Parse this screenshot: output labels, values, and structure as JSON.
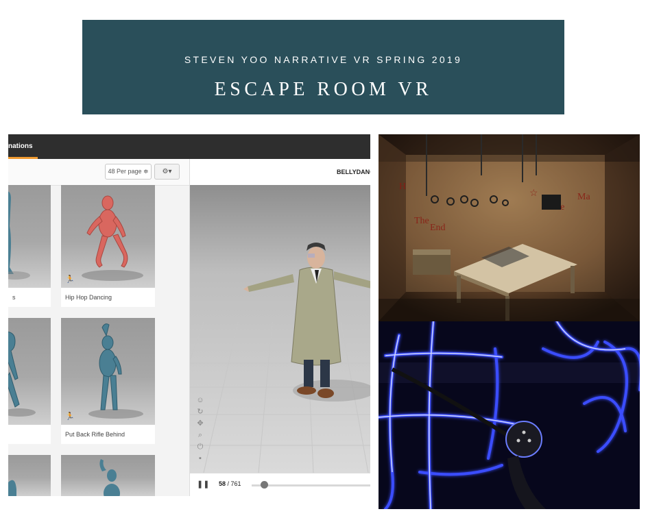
{
  "banner": {
    "subtitle": "STEVEN YOO NARRATIVE VR SPRING 2019",
    "title": "ESCAPE ROOM VR"
  },
  "mixamo": {
    "tab_label": "nations",
    "per_page_label": "48 Per page ≑",
    "gear_label": "⚙▾",
    "preview_title": "BELLYDANC",
    "cards": [
      {
        "label": "s"
      },
      {
        "label": "Hip Hop Dancing"
      },
      {
        "label": ""
      },
      {
        "label": "Put Back Rifle Behind"
      }
    ],
    "player": {
      "pause_label": "❚❚",
      "frame_current": "58",
      "frame_sep": " / ",
      "frame_total": "761",
      "progress": 0.076
    }
  },
  "colors": {
    "banner_bg": "#2a4f5a",
    "accent_orange": "#f09a30",
    "robot_red": "#d9675f",
    "robot_teal": "#4a7f93",
    "vr_glow": "#3b4dff"
  }
}
